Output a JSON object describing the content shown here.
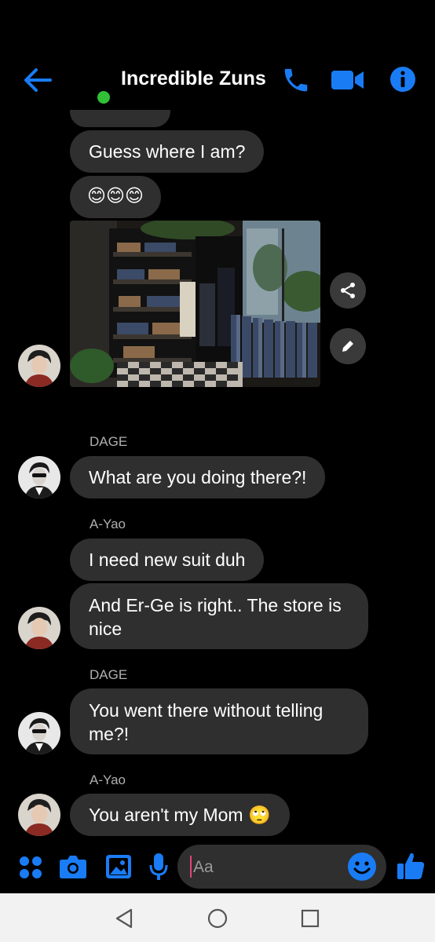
{
  "header": {
    "title": "Incredible Zuns",
    "icons": [
      "back-arrow-icon",
      "phone-icon",
      "video-camera-icon",
      "info-icon"
    ],
    "accent_color": "#1a7cf5",
    "online_color": "#31c136"
  },
  "messages": {
    "m1": "Guess where I am?",
    "m2": "😊😊😊",
    "dage_label_1": "DAGE",
    "m3": "What are you doing there?!",
    "ayao_label_1": "A-Yao",
    "m4": "I need new suit duh",
    "m5": "And Er-Ge is right.. The store is nice",
    "dage_label_2": "DAGE",
    "m6": "You went there without telling me?!",
    "ayao_label_2": "A-Yao",
    "m7": "You aren't my Mom 🙄"
  },
  "composer": {
    "placeholder": "Aa",
    "icons": [
      "menu-dots-icon",
      "camera-icon",
      "gallery-icon",
      "microphone-icon",
      "emoji-icon",
      "thumbs-up-icon"
    ]
  },
  "navbar": {
    "icons": [
      "back-triangle-icon",
      "home-circle-icon",
      "recents-square-icon"
    ]
  }
}
